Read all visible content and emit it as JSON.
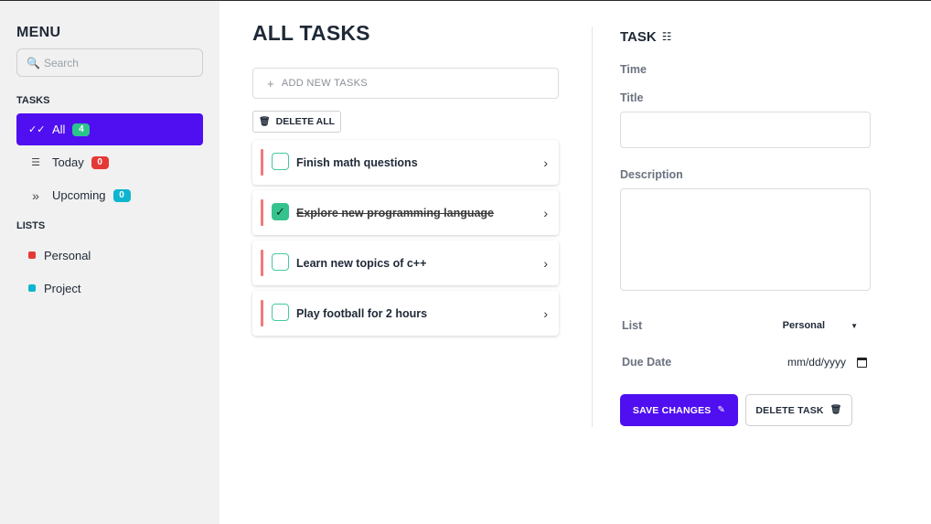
{
  "sidebar": {
    "title": "MENU",
    "search_placeholder": "Search",
    "tasks_label": "TASKS",
    "tasks": [
      {
        "label": "All",
        "count": "4",
        "icon": "double-check-icon",
        "active": true
      },
      {
        "label": "Today",
        "count": "0",
        "icon": "list-icon",
        "active": false
      },
      {
        "label": "Upcoming",
        "count": "0",
        "icon": "double-chevron-right-icon",
        "active": false
      }
    ],
    "lists_label": "LISTS",
    "lists": [
      {
        "label": "Personal",
        "color": "#e53935"
      },
      {
        "label": "Project",
        "color": "#0fb5cf"
      }
    ]
  },
  "main": {
    "title": "ALL TASKS",
    "add_label": "ADD NEW TASKS",
    "delete_all_label": "DELETE ALL",
    "tasks": [
      {
        "label": "Finish math questions",
        "done": false
      },
      {
        "label": "Explore new programming language",
        "done": true
      },
      {
        "label": "Learn new topics of c++",
        "done": false
      },
      {
        "label": "Play football for 2 hours",
        "done": false
      }
    ]
  },
  "panel": {
    "title": "TASK",
    "time_label": "Time",
    "title_label": "Title",
    "description_label": "Description",
    "list_label": "List",
    "list_value": "Personal",
    "due_label": "Due Date",
    "due_value": "mm/dd/yyyy",
    "save_label": "SAVE CHANGES",
    "delete_label": "DELETE TASK"
  },
  "colors": {
    "accent": "#4f0ff0",
    "task_bar": "#f07a7a",
    "check": "#35c28c"
  }
}
